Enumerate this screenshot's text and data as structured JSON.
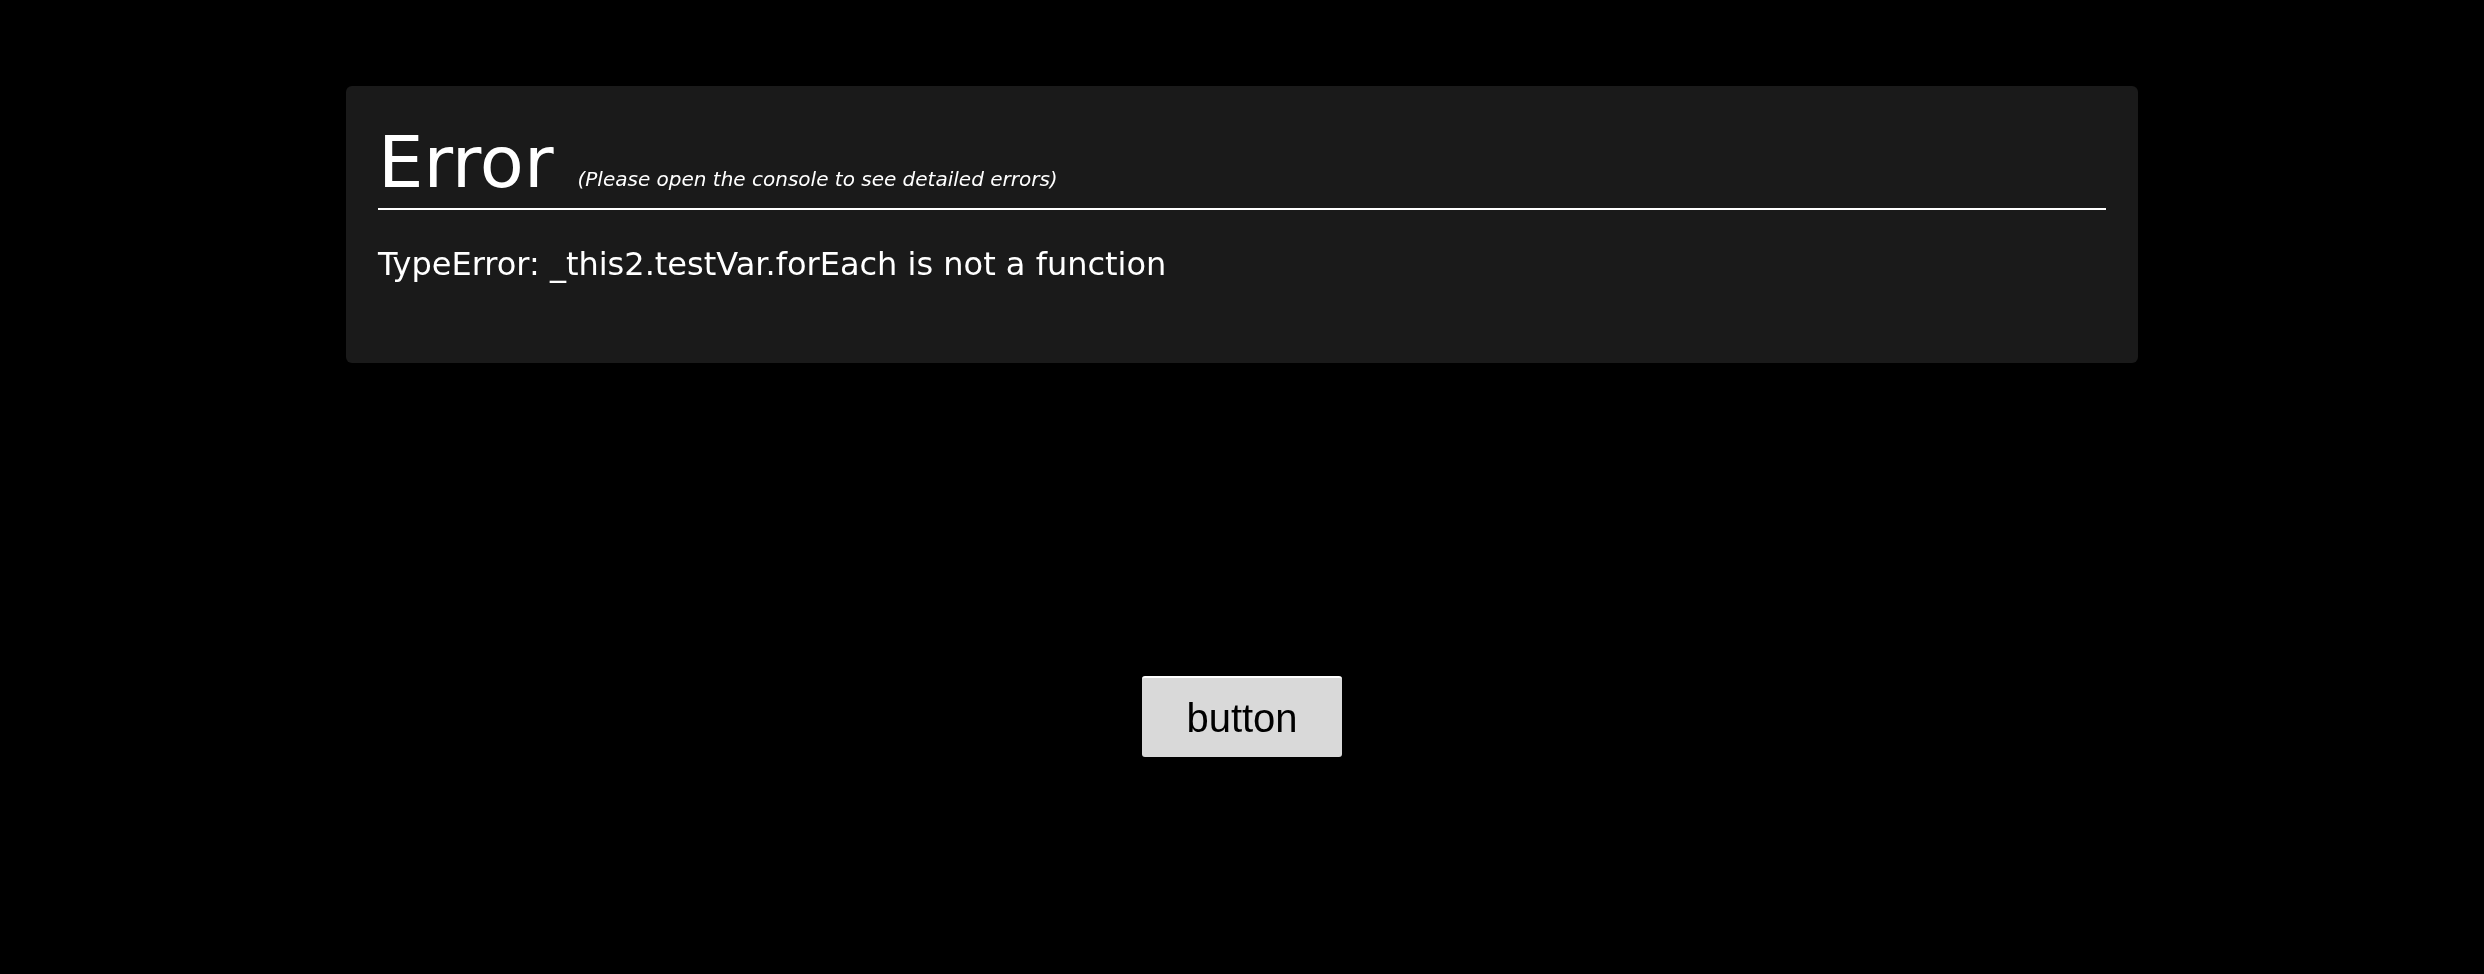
{
  "error_panel": {
    "title": "Error",
    "hint": "(Please open the console to see detailed errors)",
    "message": "TypeError: _this2.testVar.forEach is not a function"
  },
  "button": {
    "label": "button"
  }
}
